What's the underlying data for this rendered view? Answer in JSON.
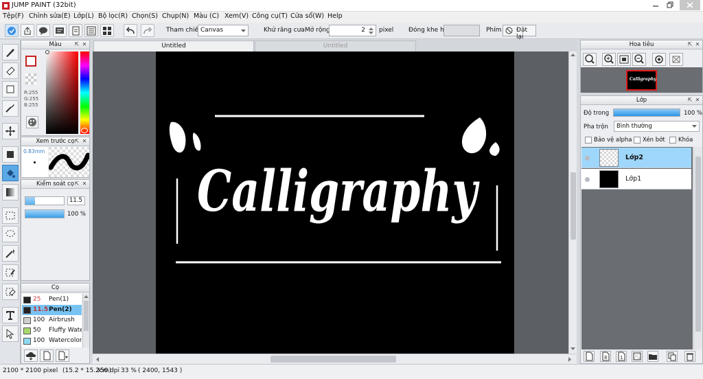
{
  "window": {
    "title": "JUMP PAINT (32bit)"
  },
  "menu": [
    "Tệp(F)",
    "Chỉnh sửa(E)",
    "Lớp(L)",
    "Bộ lọc(R)",
    "Chọn(S)",
    "Chụp(N)",
    "Màu (C)",
    "Xem(V)",
    "Công cụ(T)",
    "Cửa sổ(W)",
    "Help"
  ],
  "toolbar": {
    "reference_label": "Tham chiếu",
    "reference_value": "Canvas",
    "antialias_label": "Khử răng cưa",
    "expand_label": "Mở rộng",
    "expand_value": "2",
    "expand_unit": "pixel",
    "gap_label": "Đóng khe hở",
    "key_label": "Phím",
    "reset_label": "Đặt lại"
  },
  "color_panel": {
    "title": "Màu",
    "r": "R:255",
    "g": "G:255",
    "b": "B:255",
    "fg_color": "#ffffff"
  },
  "brush_preview": {
    "title": "Xem trước cọ",
    "size": "0.83mm"
  },
  "brush_control": {
    "title": "Kiểm soát cọ",
    "size_value": "11.5",
    "opacity_value": "100 %",
    "opacity_fraction": 1.0
  },
  "brush_panel": {
    "title": "Cọ",
    "items": [
      {
        "size": "25",
        "name": "Pen(1)",
        "color": "#222222",
        "selected": false
      },
      {
        "size": "11.5",
        "name": "Pen(2)",
        "color": "#222222",
        "selected": true
      },
      {
        "size": "100",
        "name": "Airbrush",
        "color": "#cfcfcf",
        "selected": false
      },
      {
        "size": "50",
        "name": "Fluffy Water",
        "color": "#a9d86e",
        "selected": false
      },
      {
        "size": "100",
        "name": "Watercolor",
        "color": "#8fd9ef",
        "selected": false
      }
    ]
  },
  "doc_tabs": [
    {
      "label": "Untitled",
      "active": true
    },
    {
      "label": "Untitled",
      "active": false
    }
  ],
  "artwork": {
    "text": "Calligraphy",
    "background": "#000000",
    "ink": "#ffffff"
  },
  "navigator": {
    "title": "Hoa tiêu",
    "thumb_text": "Calligraphy"
  },
  "layers_panel": {
    "title": "Lớp",
    "opacity_label": "Độ trong",
    "opacity_value": "100 %",
    "opacity_fraction": 1.0,
    "blend_label": "Pha trộn",
    "blend_value": "Bình thường",
    "protect_alpha": "Bảo vệ alpha",
    "clip": "Xén bớt",
    "lock": "Khóa",
    "layers": [
      {
        "name": "Lớp2",
        "selected": true,
        "thumb": "transparent"
      },
      {
        "name": "Lớp1",
        "selected": false,
        "thumb": "black"
      }
    ]
  },
  "status": {
    "size": "2100 * 2100 pixel",
    "physical": "(15.2 * 15.2cm)",
    "dpi": "350 dpi",
    "zoom": "33 %",
    "coords": "( 2400, 1543 )"
  }
}
